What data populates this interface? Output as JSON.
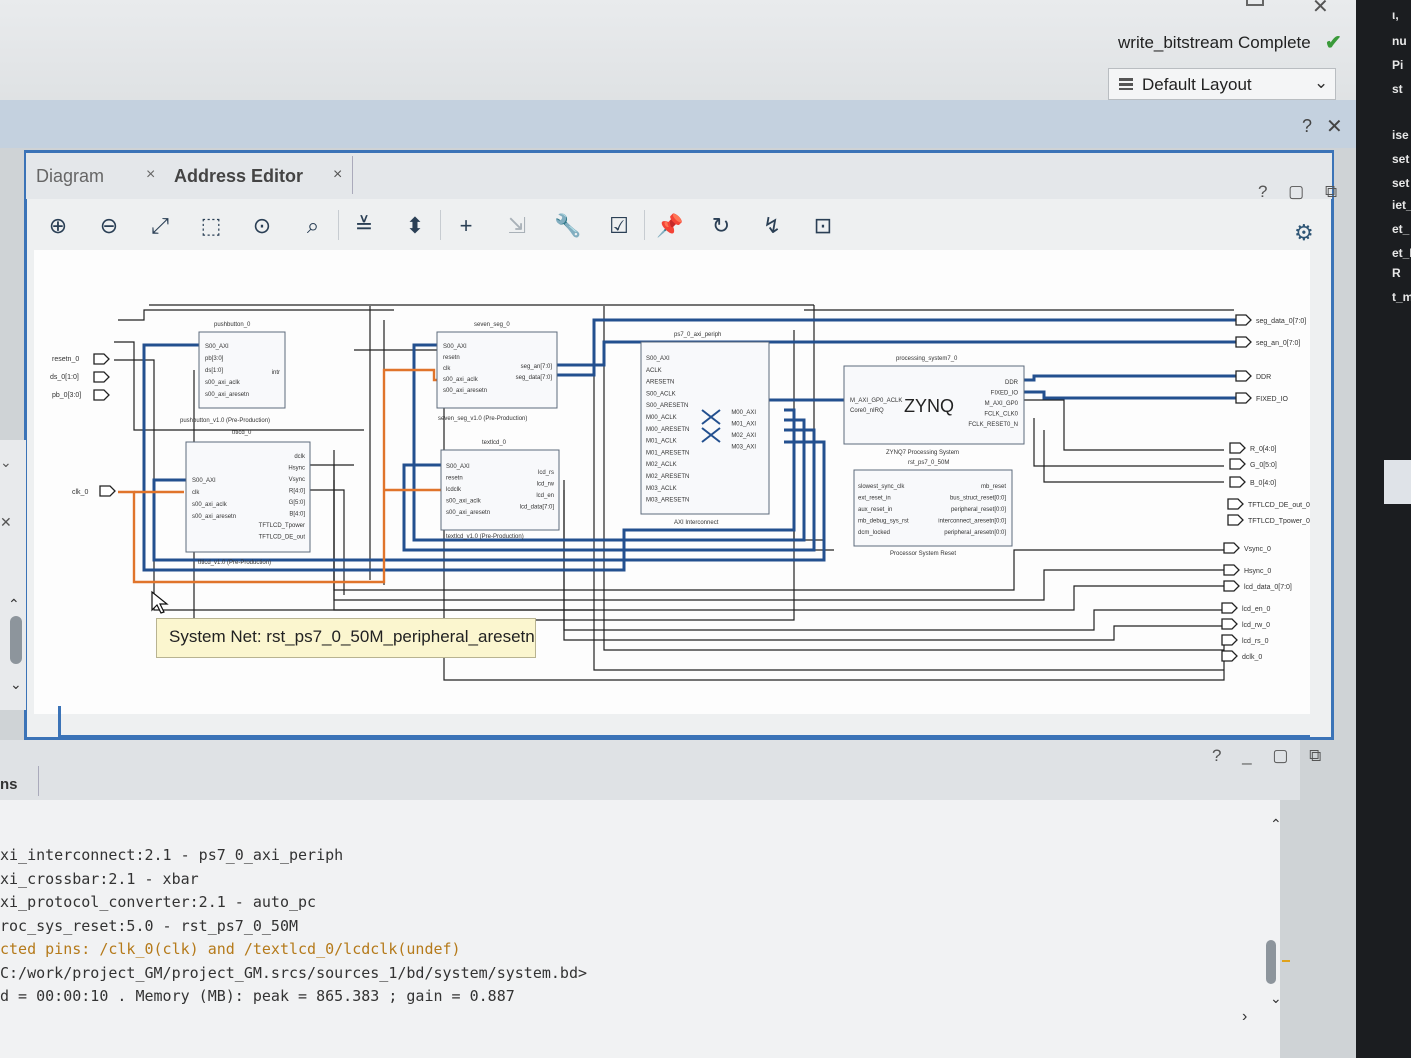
{
  "window": {
    "status_text": "write_bitstream Complete",
    "status_icon": "checkmark-icon",
    "layout_select": "Default Layout"
  },
  "band": {
    "help": "?",
    "close": "✕"
  },
  "tabs": [
    {
      "label": "Diagram",
      "close": "×"
    },
    {
      "label": "Address Editor",
      "close": "×"
    }
  ],
  "panel_controls": "? ▢ ⧉",
  "toolbar": [
    {
      "name": "zoom-in-icon",
      "glyph": "⊕"
    },
    {
      "name": "zoom-out-icon",
      "glyph": "⊖"
    },
    {
      "name": "zoom-fit-icon",
      "glyph": "⤢"
    },
    {
      "name": "zoom-area-icon",
      "glyph": "⬚"
    },
    {
      "name": "auto-fit-selection-icon",
      "glyph": "⊙"
    },
    {
      "name": "search-icon",
      "glyph": "⌕"
    },
    {
      "name": "collapse-all-icon",
      "glyph": "≚"
    },
    {
      "name": "expand-all-icon",
      "glyph": "⬍"
    },
    {
      "name": "add-ip-icon",
      "glyph": "+"
    },
    {
      "name": "make-external-icon",
      "glyph": "⇲"
    },
    {
      "name": "properties-icon",
      "glyph": "🔧"
    },
    {
      "name": "validate-design-icon",
      "glyph": "☑"
    },
    {
      "name": "pin-icon",
      "glyph": "📌"
    },
    {
      "name": "regenerate-layout-icon",
      "glyph": "↻"
    },
    {
      "name": "optimize-routing-icon",
      "glyph": "↯"
    },
    {
      "name": "ip-integrator-icon",
      "glyph": "⊡"
    }
  ],
  "diagram": {
    "inputs": [
      "resetn_0",
      "ds_0[1:0]",
      "pb_0[3:0]",
      "clk_0"
    ],
    "outputs": [
      "seg_data_0[7:0]",
      "seg_an_0[7:0]",
      "DDR",
      "FIXED_IO",
      "R_0[4:0]",
      "G_0[5:0]",
      "B_0[4:0]",
      "TFTLCD_DE_out_0",
      "TFTLCD_Tpower_0",
      "Vsync_0",
      "Hsync_0",
      "lcd_data_0[7:0]",
      "lcd_en_0",
      "lcd_rw_0",
      "lcd_rs_0",
      "dclk_0"
    ],
    "blocks": {
      "pushbutton": {
        "name": "pushbutton_0",
        "sub": "pushbutton_v1.0 (Pre-Production)",
        "pins_in": [
          "S00_AXI",
          "pb[3:0]",
          "ds[1:0]",
          "s00_axi_aclk",
          "s00_axi_aresetn"
        ],
        "pins_out": [
          "intr"
        ]
      },
      "tftlcd": {
        "name": "tftlcd_0",
        "sub": "tftlcd_v1.0 (Pre-Production)",
        "pins_in": [
          "S00_AXI",
          "clk",
          "s00_axi_aclk",
          "s00_axi_aresetn"
        ],
        "pins_out": [
          "dclk",
          "Hsync",
          "Vsync",
          "R[4:0]",
          "G[5:0]",
          "B[4:0]",
          "TFTLCD_Tpower",
          "TFTLCD_DE_out"
        ]
      },
      "sevenseg": {
        "name": "seven_seg_0",
        "sub": "seven_seg_v1.0 (Pre-Production)",
        "pins_in": [
          "S00_AXI",
          "resetn",
          "clk",
          "s00_axi_aclk",
          "s00_axi_aresetn"
        ],
        "pins_out": [
          "seg_an[7:0]",
          "seg_data[7:0]"
        ]
      },
      "textlcd": {
        "name": "textlcd_0",
        "sub": "textlcd_v1.0 (Pre-Production)",
        "pins_in": [
          "S00_AXI",
          "resetn",
          "lcdclk",
          "s00_axi_aclk",
          "s00_axi_aresetn"
        ],
        "pins_out": [
          "lcd_rs",
          "lcd_rw",
          "lcd_en",
          "lcd_data[7:0]"
        ]
      },
      "interconnect": {
        "name": "ps7_0_axi_periph",
        "sub": "AXI Interconnect",
        "pins_in": [
          "S00_AXI",
          "ACLK",
          "ARESETN",
          "S00_ACLK",
          "S00_ARESETN",
          "M00_ACLK",
          "M00_ARESETN",
          "M01_ACLK",
          "M01_ARESETN",
          "M02_ACLK",
          "M02_ARESETN",
          "M03_ACLK",
          "M03_ARESETN"
        ],
        "pins_out": [
          "M00_AXI",
          "M01_AXI",
          "M02_AXI",
          "M03_AXI"
        ]
      },
      "ps": {
        "name": "processing_system7_0",
        "sub": "ZYNQ7 Processing System",
        "logo": "ZYNQ",
        "pins_in": [
          "M_AXI_GP0_ACLK",
          "Core0_nIRQ"
        ],
        "pins_out": [
          "DDR",
          "FIXED_IO",
          "M_AXI_GP0",
          "FCLK_CLK0",
          "FCLK_RESET0_N"
        ]
      },
      "reset": {
        "name": "rst_ps7_0_50M",
        "sub": "Processor System Reset",
        "pins_in": [
          "slowest_sync_clk",
          "ext_reset_in",
          "aux_reset_in",
          "mb_debug_sys_rst",
          "dcm_locked"
        ],
        "pins_out": [
          "mb_reset",
          "bus_struct_reset[0:0]",
          "peripheral_reset[0:0]",
          "interconnect_aresetn[0:0]",
          "peripheral_aresetn[0:0]"
        ]
      }
    }
  },
  "tooltip": "System Net: rst_ps7_0_50M_peripheral_aresetn",
  "lower_panel": {
    "tab_label": "ns",
    "controls": "? _ ▢ ⧉"
  },
  "console": [
    "xi_interconnect:2.1 - ps7_0_axi_periph",
    "xi_crossbar:2.1 - xbar",
    "xi_protocol_converter:2.1 - auto_pc",
    "roc_sys_reset:5.0 - rst_ps7_0_50M",
    "cted pins: /clk_0(clk) and /textlcd_0/lcdclk(undef)",
    "C:/work/project_GM/project_GM.srcs/sources_1/bd/system/system.bd>",
    "d = 00:00:10 . Memory (MB): peak = 865.383 ; gain = 0.887"
  ],
  "right_strip": [
    "ι,",
    "nu",
    "Pi",
    "st",
    "ise",
    "set",
    "set",
    "iet_",
    "et_",
    "et_I",
    "R",
    "t_m"
  ]
}
